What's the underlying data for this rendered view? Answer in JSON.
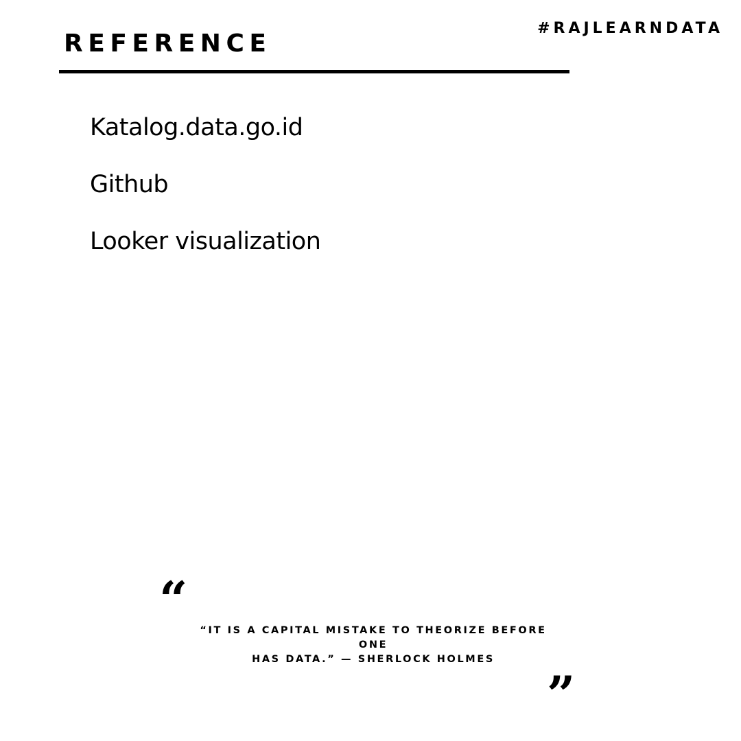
{
  "header": {
    "title": "REFERENCE",
    "hashtag": "#RAJLEARNDATA"
  },
  "references": [
    "Katalog.data.go.id",
    "Github",
    "Looker visualization"
  ],
  "quote": {
    "open_mark": "“",
    "close_mark": "”",
    "text_line1": "“IT IS A CAPITAL MISTAKE TO THEORIZE BEFORE ONE",
    "text_line2": "HAS DATA.” — SHERLOCK HOLMES"
  },
  "colors": {
    "background": "#ffffff",
    "text": "#000000"
  }
}
